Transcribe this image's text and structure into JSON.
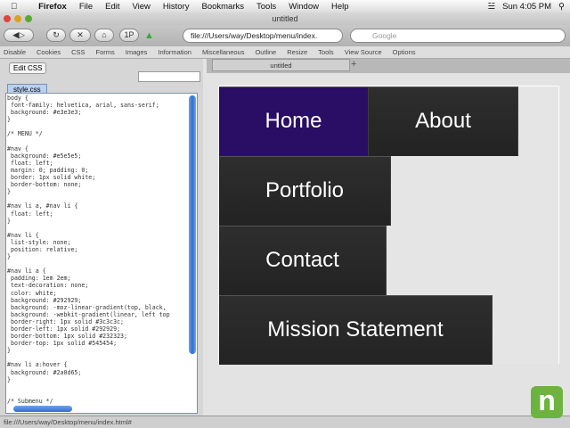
{
  "menubar": {
    "app": "Firefox",
    "items": [
      "File",
      "Edit",
      "View",
      "History",
      "Bookmarks",
      "Tools",
      "Window",
      "Help"
    ],
    "clock": "Sun 4:05 PM"
  },
  "window": {
    "title": "untitled"
  },
  "toolbar": {
    "url": "file:///Users/way/Desktop/menu/index.",
    "search_placeholder": "Google",
    "onep": "1P"
  },
  "webdev": {
    "items": [
      "Disable",
      "Cookies",
      "CSS",
      "Forms",
      "Images",
      "Information",
      "Miscellaneous",
      "Outline",
      "Resize",
      "Tools",
      "View Source",
      "Options"
    ]
  },
  "sidebar": {
    "tooltip": "Edit CSS",
    "file_tab": "style.css",
    "code": "body {\n font-family: helvetica, arial, sans-serif;\n background: #e3e3e3;\n}\n\n/* MENU */\n\n#nav {\n background: #e5e5e5;\n float: left;\n margin: 0; padding: 0;\n border: 1px solid white;\n border-bottom: none;\n}\n\n#nav li a, #nav li {\n float: left;\n}\n\n#nav li {\n list-style: none;\n position: relative;\n}\n\n#nav li a {\n padding: 1em 2em;\n text-decoration: none;\n color: white;\n background: #292929;\n background: -moz-linear-gradient(top, black,\n background: -webkit-gradient(linear, left top\n border-right: 1px solid #3c3c3c;\n border-left: 1px solid #292929;\n border-bottom: 1px solid #232323;\n border-top: 1px solid #545454;\n}\n\n#nav li a:hover {\n background: #2a0d65;\n}\n\n\n/* Submenu */"
  },
  "tab": {
    "label": "untitled"
  },
  "nav": {
    "items": [
      "Home",
      "About",
      "Portfolio",
      "Contact",
      "Mission Statement"
    ],
    "hover_color": "#2a0d65"
  },
  "status": {
    "text": "file:///Users/way/Desktop/menu/index.html#"
  },
  "logo": {
    "text": "n"
  }
}
